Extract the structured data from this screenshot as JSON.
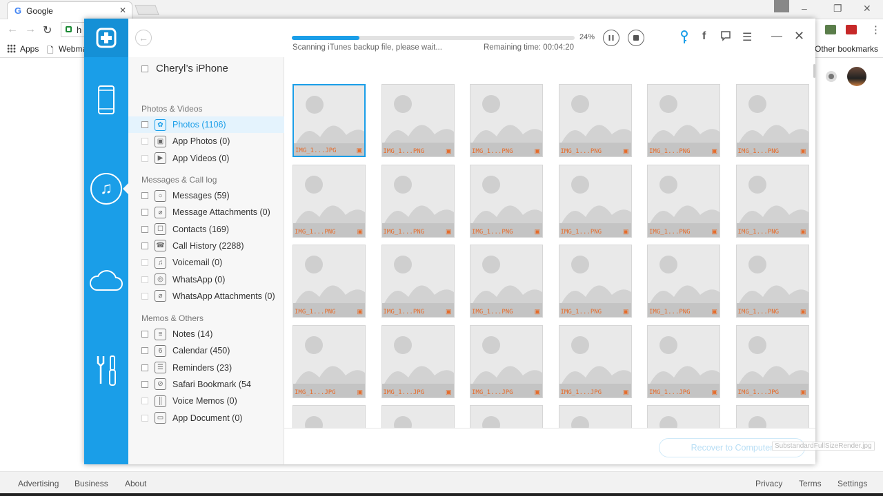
{
  "browser": {
    "tab_title": "Google",
    "address_text": "h",
    "bookmarks": {
      "apps": "Apps",
      "webmail": "Webma",
      "other": "Other bookmarks"
    },
    "footer": {
      "advertising": "Advertising",
      "business": "Business",
      "about": "About",
      "privacy": "Privacy",
      "terms": "Terms",
      "settings": "Settings"
    }
  },
  "app": {
    "scan": {
      "progress_percent": 24,
      "progress_label": "24%",
      "status": "Scanning iTunes backup file, please wait...",
      "remaining": "Remaining time: 00:04:20"
    },
    "device_name": "Cheryl’s iPhone",
    "groups": [
      {
        "title": "Photos & Videos",
        "items": [
          {
            "label": "Photos (1106)",
            "icon": "photos-icon",
            "active": true,
            "enabled": true
          },
          {
            "label": "App Photos (0)",
            "icon": "app-photos-icon",
            "active": false,
            "enabled": false
          },
          {
            "label": "App Videos (0)",
            "icon": "app-videos-icon",
            "active": false,
            "enabled": false
          }
        ]
      },
      {
        "title": "Messages & Call log",
        "items": [
          {
            "label": "Messages (59)",
            "icon": "messages-icon",
            "active": false,
            "enabled": true
          },
          {
            "label": "Message Attachments (0)",
            "icon": "attachment-icon",
            "active": false,
            "enabled": true
          },
          {
            "label": "Contacts (169)",
            "icon": "contacts-icon",
            "active": false,
            "enabled": true
          },
          {
            "label": "Call History (2288)",
            "icon": "phone-icon",
            "active": false,
            "enabled": true
          },
          {
            "label": "Voicemail (0)",
            "icon": "voicemail-icon",
            "active": false,
            "enabled": false
          },
          {
            "label": "WhatsApp (0)",
            "icon": "whatsapp-icon",
            "active": false,
            "enabled": false
          },
          {
            "label": "WhatsApp Attachments (0)",
            "icon": "attachment-icon",
            "active": false,
            "enabled": false
          }
        ]
      },
      {
        "title": "Memos & Others",
        "items": [
          {
            "label": "Notes (14)",
            "icon": "notes-icon",
            "active": false,
            "enabled": true
          },
          {
            "label": "Calendar (450)",
            "icon": "calendar-icon",
            "active": false,
            "enabled": true
          },
          {
            "label": "Reminders (23)",
            "icon": "reminders-icon",
            "active": false,
            "enabled": true
          },
          {
            "label": "Safari Bookmark (54",
            "icon": "compass-icon",
            "active": false,
            "enabled": true
          },
          {
            "label": "Voice Memos (0)",
            "icon": "waveform-icon",
            "active": false,
            "enabled": false
          },
          {
            "label": "App Document (0)",
            "icon": "folder-icon",
            "active": false,
            "enabled": false
          }
        ]
      }
    ],
    "thumbnails": [
      {
        "caption": "IMG_1...JPG",
        "selected": true
      },
      {
        "caption": "IMG_1...PNG"
      },
      {
        "caption": "IMG_1...PNG"
      },
      {
        "caption": "IMG_1...PNG"
      },
      {
        "caption": "IMG_1...PNG"
      },
      {
        "caption": "IMG_1...PNG"
      },
      {
        "caption": "IMG_1...PNG"
      },
      {
        "caption": "IMG_1...PNG"
      },
      {
        "caption": "IMG_1...PNG"
      },
      {
        "caption": "IMG_1...PNG"
      },
      {
        "caption": "IMG_1...PNG"
      },
      {
        "caption": "IMG_1...PNG"
      },
      {
        "caption": "IMG_1...PNG"
      },
      {
        "caption": "IMG_1...PNG"
      },
      {
        "caption": "IMG_1...PNG"
      },
      {
        "caption": "IMG_1...PNG"
      },
      {
        "caption": "IMG_1...PNG"
      },
      {
        "caption": "IMG_1...PNG"
      },
      {
        "caption": "IMG_1...JPG"
      },
      {
        "caption": "IMG_1...JPG"
      },
      {
        "caption": "IMG_1...JPG"
      },
      {
        "caption": "IMG_1...JPG"
      },
      {
        "caption": "IMG_1...JPG"
      },
      {
        "caption": "IMG_1...JPG"
      },
      {
        "caption": ""
      },
      {
        "caption": ""
      },
      {
        "caption": ""
      },
      {
        "caption": ""
      },
      {
        "caption": ""
      },
      {
        "caption": ""
      }
    ],
    "recover_button": "Recover to Computer",
    "filename_tooltip": "SubstandardFullSizeRender.jpg"
  },
  "colors": {
    "accent": "#1a9ee8",
    "caption": "#e56b2a"
  }
}
